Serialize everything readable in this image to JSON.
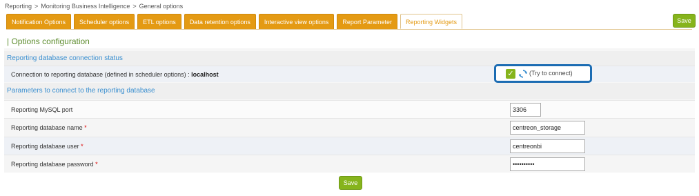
{
  "breadcrumb": [
    "Reporting",
    "Monitoring Business Intelligence",
    "General options"
  ],
  "breadcrumb_sep": ">",
  "tabs": [
    {
      "label": "Notification Options"
    },
    {
      "label": "Scheduler options"
    },
    {
      "label": "ETL options"
    },
    {
      "label": "Data retention options"
    },
    {
      "label": "Interactive view options"
    },
    {
      "label": "Report Parameter"
    },
    {
      "label": "Reporting Widgets",
      "active": true
    }
  ],
  "save_label": "Save",
  "section_title": "| Options configuration",
  "connection_status": {
    "header": "Reporting database connection status",
    "label": "Connection to reporting database (defined in scheduler options) : ",
    "host": "localhost",
    "try_connect": "(Try to connect)"
  },
  "params": {
    "header": "Parameters to connect to the reporting database",
    "port": {
      "label": "Reporting MySQL port",
      "value": "3306"
    },
    "db_name": {
      "label": "Reporting database name",
      "value": "centreon_storage",
      "required": "*"
    },
    "db_user": {
      "label": "Reporting database user",
      "value": "centreonbi",
      "required": "*"
    },
    "db_password": {
      "label": "Reporting database password",
      "value": "••••••••••",
      "required": "*"
    }
  },
  "colors": {
    "tab": "#e49a13",
    "save": "#86b41c",
    "highlight": "#1b6cb3",
    "section_header": "#3a8fd0"
  }
}
